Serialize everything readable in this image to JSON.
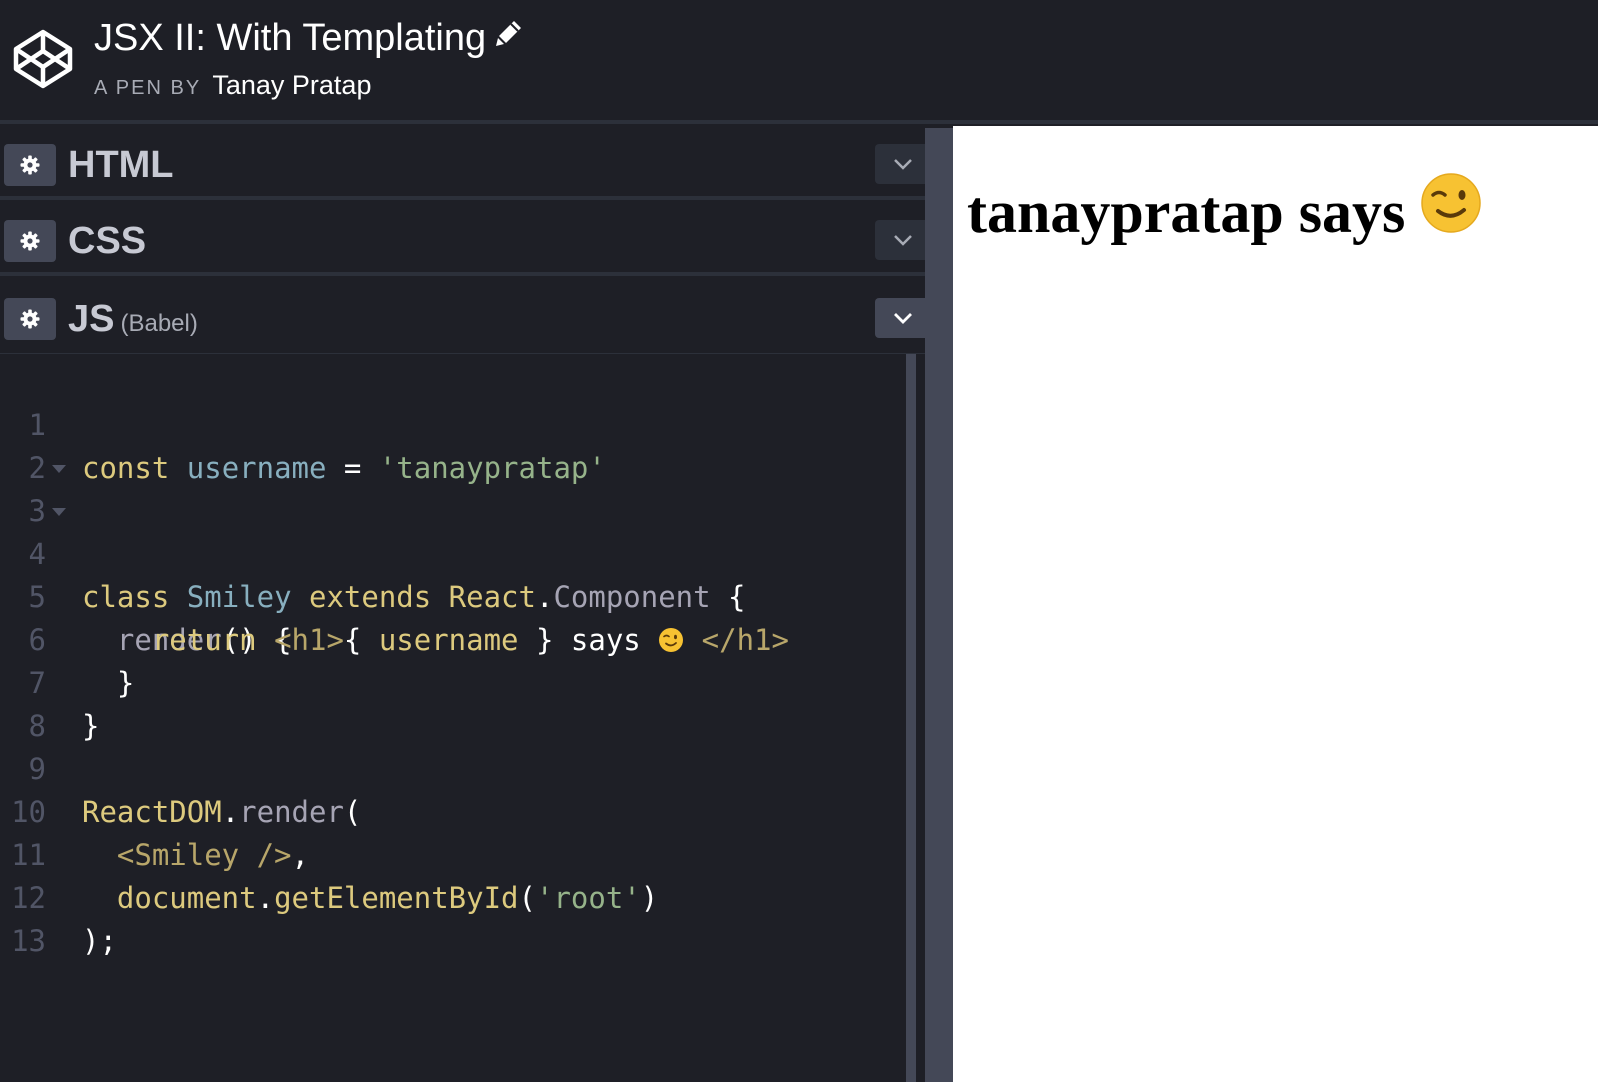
{
  "header": {
    "pen_title": "JSX II: With Templating",
    "byline_prefix": "A PEN BY",
    "author": "Tanay Pratap"
  },
  "panels": [
    {
      "label": "HTML",
      "sub": ""
    },
    {
      "label": "CSS",
      "sub": ""
    },
    {
      "label": "JS",
      "sub": "(Babel)"
    }
  ],
  "code": {
    "line_numbers": [
      "1",
      "2",
      "3",
      "4",
      "5",
      "6",
      "7",
      "8",
      "9",
      "10",
      "11",
      "12",
      "13"
    ],
    "l1": {
      "a": "const",
      "b": " username",
      "c": " = ",
      "d": "'tanaypratap'"
    },
    "l3": {
      "a": "class",
      "b": " Smiley",
      "c": " extends",
      "d": " React",
      "e": ".",
      "f": "Component",
      "g": " {"
    },
    "l4": {
      "a": "  render",
      "b": "() {"
    },
    "l5": {
      "a": "    return",
      "b": " <h1>",
      "c": "{ ",
      "d": "username",
      "e": " } says ",
      "f": " </h1>"
    },
    "l6": {
      "a": "  }"
    },
    "l7": {
      "a": "}"
    },
    "l9": {
      "a": "ReactDOM",
      "b": ".",
      "c": "render",
      "d": "("
    },
    "l10": {
      "a": "  <Smiley />",
      "b": ","
    },
    "l11": {
      "a": "  document",
      "b": ".",
      "c": "getElementById",
      "d": "(",
      "e": "'root'",
      "f": ")"
    },
    "l12": {
      "a": ");"
    }
  },
  "preview": {
    "heading_text": "tanaypratap says"
  },
  "icons": {
    "logo": "codepen-logo-icon",
    "edit": "pencil-icon",
    "settings": "gear-icon",
    "collapse": "chevron-down-icon",
    "emoji": "winking-face-emoji-icon"
  },
  "colors": {
    "background": "#1e1f26",
    "panel_border": "#2c303a",
    "button": "#444857",
    "keyword": "#ddca7e",
    "variable": "#88afbf",
    "string": "#96b38a",
    "tag": "#b8a66a"
  }
}
